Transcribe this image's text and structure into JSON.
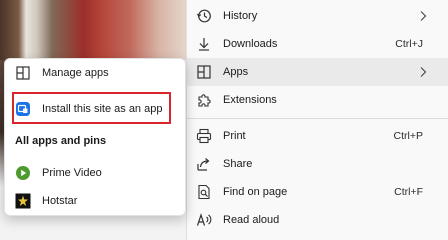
{
  "main_menu": {
    "items": [
      {
        "label": "History",
        "shortcut": "",
        "icon": "history-icon",
        "submenu": true
      },
      {
        "label": "Downloads",
        "shortcut": "Ctrl+J",
        "icon": "download-icon",
        "submenu": false
      },
      {
        "label": "Apps",
        "shortcut": "",
        "icon": "apps-icon",
        "submenu": true,
        "highlighted": true
      },
      {
        "label": "Extensions",
        "shortcut": "",
        "icon": "extensions-icon",
        "submenu": false
      },
      {
        "label": "Print",
        "shortcut": "Ctrl+P",
        "icon": "print-icon",
        "submenu": false
      },
      {
        "label": "Share",
        "shortcut": "",
        "icon": "share-icon",
        "submenu": false
      },
      {
        "label": "Find on page",
        "shortcut": "Ctrl+F",
        "icon": "find-icon",
        "submenu": false
      },
      {
        "label": "Read aloud",
        "shortcut": "",
        "icon": "read-aloud-icon",
        "submenu": false
      }
    ]
  },
  "apps_flyout": {
    "manage_apps": "Manage apps",
    "install_site": "Install this site as an app",
    "section_title": "All apps and pins",
    "apps": [
      {
        "label": "Prime Video",
        "icon": "prime-video-icon"
      },
      {
        "label": "Hotstar",
        "icon": "hotstar-icon"
      }
    ]
  },
  "colors": {
    "highlight_box": "#d9262c",
    "install_icon": "#1a73e8",
    "prime_video_icon": "#4e9a2e",
    "hotstar_icon": "#111111"
  }
}
